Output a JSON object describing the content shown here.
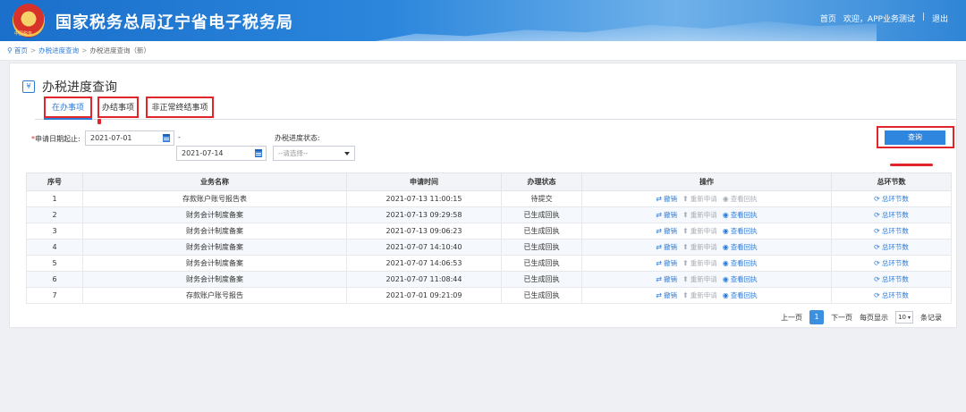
{
  "header": {
    "title": "国家税务总局辽宁省电子税务局",
    "emblem_text": "中国税务",
    "nav": {
      "home": "首页",
      "welcome": "欢迎，APP业务测试",
      "separator": "|",
      "logout": "退出"
    }
  },
  "breadcrumb": {
    "home": "首页",
    "parent": "办税进度查询",
    "current": "办税进度查询（新）",
    "arrow": ">"
  },
  "page": {
    "title": "办税进度查询",
    "icon_text": "¥"
  },
  "tabs": [
    {
      "label": "在办事项",
      "active": true
    },
    {
      "label": "办结事项",
      "active": false
    },
    {
      "label": "非正常终结事项",
      "active": false
    }
  ],
  "filters": {
    "date_label_required": "*",
    "date_label": "申请日期起止:",
    "date_start": "2021-07-01",
    "date_dash": "-",
    "date_end": "2021-07-14",
    "status_label": "办税进度状态:",
    "status_placeholder": "--请选择--",
    "query_button": "查询"
  },
  "table": {
    "columns": [
      "序号",
      "业务名称",
      "申请时间",
      "办理状态",
      "操作",
      "总环节数"
    ],
    "rows": [
      {
        "no": "1",
        "name": "存款账户账号报告表",
        "time": "2021-07-13 11:00:15",
        "status": "待提交",
        "view_enabled": false
      },
      {
        "no": "2",
        "name": "财务会计制度备案",
        "time": "2021-07-13 09:29:58",
        "status": "已生成回执",
        "view_enabled": true
      },
      {
        "no": "3",
        "name": "财务会计制度备案",
        "time": "2021-07-13 09:06:23",
        "status": "已生成回执",
        "view_enabled": true
      },
      {
        "no": "4",
        "name": "财务会计制度备案",
        "time": "2021-07-07 14:10:40",
        "status": "已生成回执",
        "view_enabled": true
      },
      {
        "no": "5",
        "name": "财务会计制度备案",
        "time": "2021-07-07 14:06:53",
        "status": "已生成回执",
        "view_enabled": true
      },
      {
        "no": "6",
        "name": "财务会计制度备案",
        "time": "2021-07-07 11:08:44",
        "status": "已生成回执",
        "view_enabled": true
      },
      {
        "no": "7",
        "name": "存款账户账号报告",
        "time": "2021-07-01 09:21:09",
        "status": "已生成回执",
        "view_enabled": true
      }
    ],
    "actions": {
      "revoke": "撤销",
      "reapply": "重新申请",
      "view_receipt": "查看回执"
    },
    "steps_link": "总环节数"
  },
  "pagination": {
    "prev": "上一页",
    "current_page": "1",
    "next": "下一页",
    "per_page_label": "每页显示",
    "per_page": "10",
    "unit": "条记录"
  },
  "colors": {
    "header_blue": "#2b86dc",
    "accent_blue": "#2e7bd6",
    "highlight_red": "#e0252b"
  }
}
